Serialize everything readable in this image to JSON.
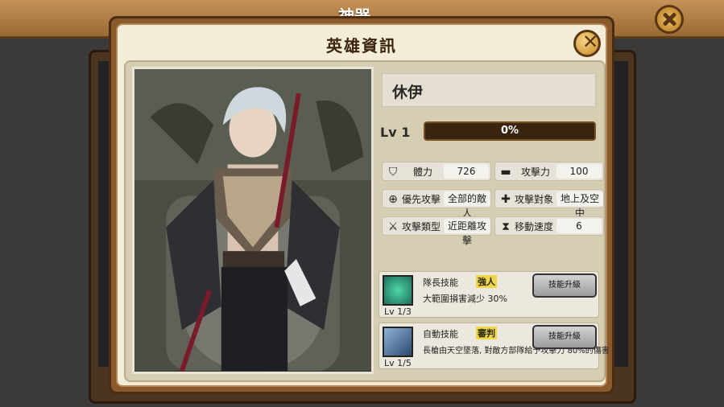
{
  "background": {
    "title": "神器"
  },
  "dialog": {
    "title": "英雄資訊"
  },
  "hero": {
    "name": "休伊",
    "level_label": "Lv 1",
    "xp_text": "0%",
    "xp_fraction": 0.0
  },
  "stats": [
    {
      "icon": "shield-icon",
      "label": "體力",
      "value": "726"
    },
    {
      "icon": "cannon-icon",
      "label": "攻擊力",
      "value": "100"
    },
    {
      "icon": "target-icon",
      "label": "優先攻擊",
      "value": "全部的敵人"
    },
    {
      "icon": "crosshair-icon",
      "label": "攻擊對象",
      "value": "地上及空中"
    },
    {
      "icon": "sword-icon",
      "label": "攻擊類型",
      "value": "近距離攻擊"
    },
    {
      "icon": "hourglass-icon",
      "label": "移動速度",
      "value": "6"
    }
  ],
  "skills": [
    {
      "type": "隊長技能",
      "name": "強人",
      "desc": "大範圍損害減少 30%",
      "level": "Lv 1/3",
      "button": "技能升級",
      "color": "#1e6e5a"
    },
    {
      "type": "自動技能",
      "name": "審判",
      "desc": "長槍由天空墜落, 對敵方部隊給予攻擊力 80%的傷害",
      "level": "Lv 1/5",
      "button": "技能升級",
      "color": "#2b4a6e"
    }
  ]
}
